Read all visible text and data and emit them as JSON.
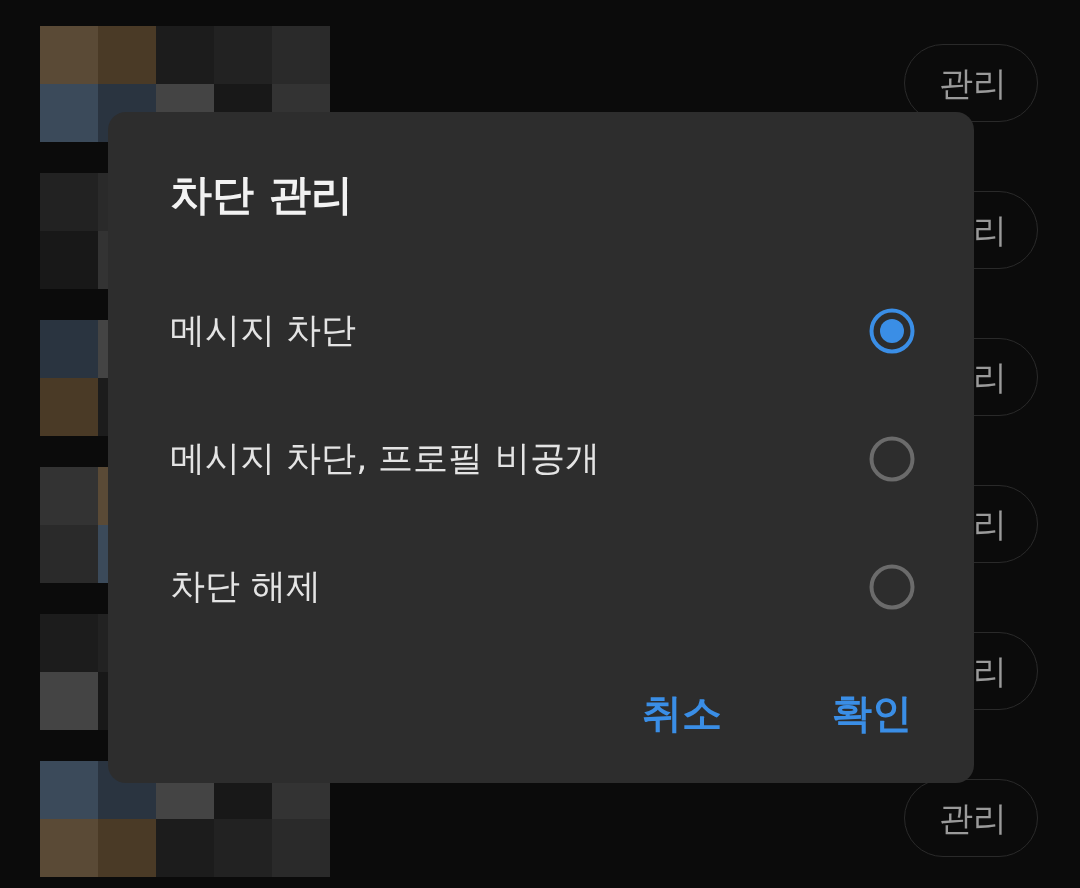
{
  "background_list": {
    "rows": [
      {
        "kind": "picture",
        "manage_button": "관리"
      },
      {
        "kind": "picture",
        "manage_button": "리"
      },
      {
        "kind": "picture",
        "manage_button": "리"
      },
      {
        "kind": "picture",
        "manage_button": "리"
      },
      {
        "kind": "picture",
        "manage_button": "리"
      },
      {
        "kind": "picture",
        "manage_button": "관리"
      }
    ]
  },
  "dialog": {
    "title": "차단 관리",
    "options": [
      {
        "label": "메시지 차단",
        "selected": true
      },
      {
        "label": "메시지 차단, 프로필 비공개",
        "selected": false
      },
      {
        "label": "차단 해제",
        "selected": false
      }
    ],
    "buttons": [
      "취소",
      "확인"
    ]
  }
}
